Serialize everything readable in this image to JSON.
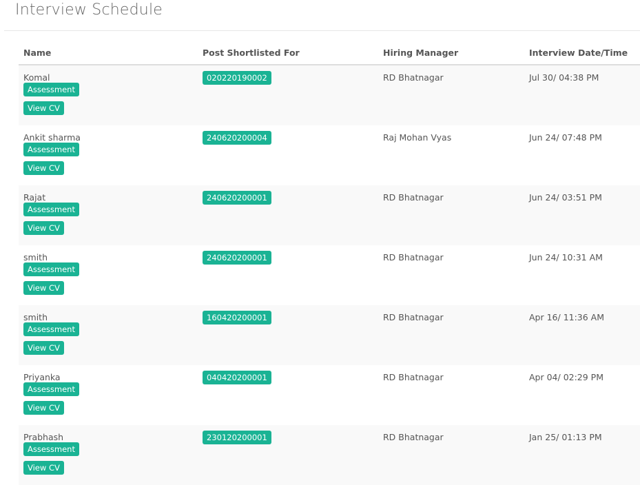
{
  "page": {
    "title": "Interview Schedule"
  },
  "table": {
    "headers": {
      "name": "Name",
      "post": "Post Shortlisted For",
      "manager": "Hiring Manager",
      "date": "Interview Date/Time"
    },
    "assessment_label": "Assessment",
    "view_cv_label": "View CV",
    "rows": [
      {
        "name": "Komal",
        "post": "020220190002",
        "manager": "RD Bhatnagar",
        "datetime": "Jul 30/ 04:38 PM"
      },
      {
        "name": "Ankit sharma",
        "post": "240620200004",
        "manager": "Raj Mohan Vyas",
        "datetime": "Jun 24/ 07:48 PM"
      },
      {
        "name": "Rajat",
        "post": "240620200001",
        "manager": "RD Bhatnagar",
        "datetime": "Jun 24/ 03:51 PM"
      },
      {
        "name": "smith",
        "post": "240620200001",
        "manager": "RD Bhatnagar",
        "datetime": "Jun 24/ 10:31 AM"
      },
      {
        "name": "smith",
        "post": "160420200001",
        "manager": "RD Bhatnagar",
        "datetime": "Apr 16/ 11:36 AM"
      },
      {
        "name": "Priyanka",
        "post": "040420200001",
        "manager": "RD Bhatnagar",
        "datetime": "Apr 04/ 02:29 PM"
      },
      {
        "name": "Prabhash",
        "post": "230120200001",
        "manager": "RD Bhatnagar",
        "datetime": "Jan 25/ 01:13 PM"
      }
    ]
  },
  "colors": {
    "accent": "#1ab394",
    "stripe": "#f9f9f9",
    "text": "#555555"
  }
}
